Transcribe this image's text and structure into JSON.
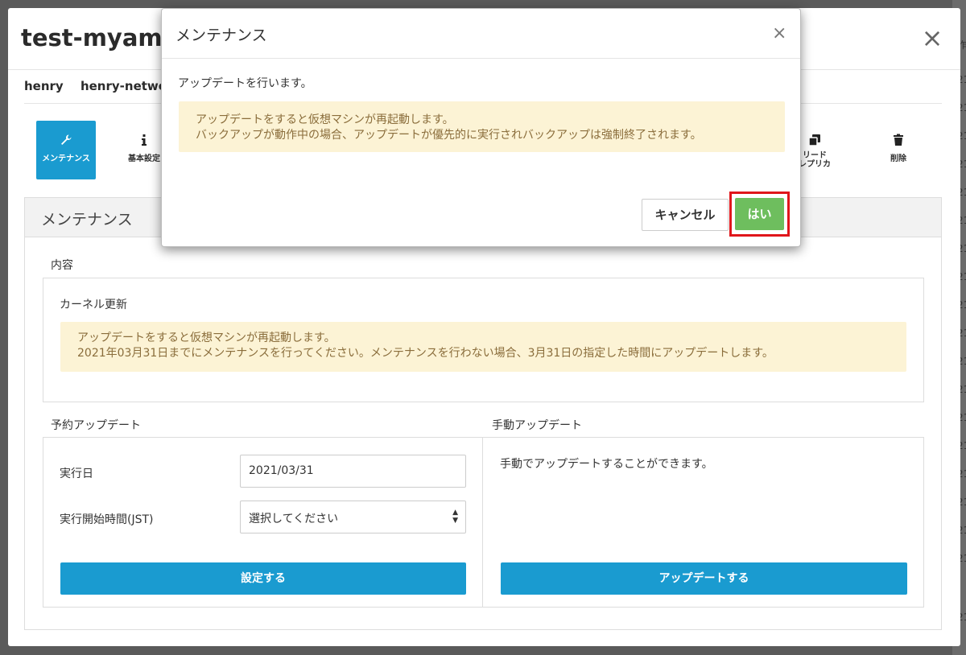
{
  "backdrop": {
    "right_glyphs": [
      "作",
      "21",
      "21",
      "21",
      "21",
      "21",
      "21",
      "21",
      "21",
      "21",
      "21",
      "21",
      "21",
      "21",
      "21",
      "21",
      "21",
      "21",
      "21",
      "21"
    ]
  },
  "main_modal": {
    "title": "test-myam",
    "close_icon": "×",
    "breadcrumb": [
      "henry",
      "henry-netwo"
    ],
    "toolbar": {
      "maintenance": "メンテナンス",
      "basic_settings": "基本設定",
      "read_replica_line1": "リード",
      "read_replica_line2": "レプリカ",
      "delete": "削除"
    },
    "panel_title": "メンテナンス",
    "content_label": "内容",
    "kernel_title": "カーネル更新",
    "kernel_warning_line1": "アップデートをすると仮想マシンが再起動します。",
    "kernel_warning_line2": "2021年03月31日までにメンテナンスを行ってください。メンテナンスを行わない場合、3月31日の指定した時間にアップデートします。",
    "scheduled": {
      "heading": "予約アップデート",
      "date_label": "実行日",
      "date_value": "2021/03/31",
      "time_label": "実行開始時間(JST)",
      "time_value": "選択してください",
      "submit": "設定する"
    },
    "manual": {
      "heading": "手動アップデート",
      "text": "手動でアップデートすることができます。",
      "submit": "アップデートする"
    }
  },
  "dialog": {
    "title": "メンテナンス",
    "close_icon": "×",
    "message": "アップデートを行います。",
    "warning_line1": "アップデートをすると仮想マシンが再起動します。",
    "warning_line2": "バックアップが動作中の場合、アップデートが優先的に実行されバックアップは強制終了されます。",
    "cancel": "キャンセル",
    "confirm": "はい"
  },
  "colors": {
    "primary": "#1a9bd0",
    "confirm": "#6ebe5e",
    "highlight": "#e0161b",
    "warning_bg": "#fcf3d5",
    "warning_text": "#8a6d3b"
  }
}
